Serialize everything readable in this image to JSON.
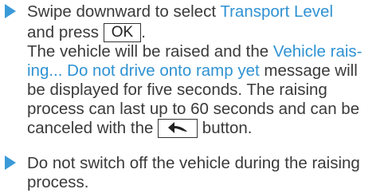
{
  "steps": [
    {
      "intro": "Swipe downward to select ",
      "highlight1": "Transport Level",
      "and_press": "and press ",
      "key_label": "OK",
      "period": ".",
      "line_a": "The vehicle will be raised and the ",
      "highlight2a": "Vehicle rais-",
      "highlight2b": "ing... Do not drive onto ramp yet",
      "line_b": " message will",
      "line_c": "be displayed for five seconds. The raising",
      "line_d": "process can last up to 60 seconds and can be",
      "line_e": "canceled with the ",
      "line_e_end": " button."
    },
    {
      "line_a": "Do not switch off the vehicle during the raising",
      "line_b": "process."
    }
  ],
  "icons": {
    "back_key": "back-arrow-icon"
  },
  "colors": {
    "accent": "#2f92d2",
    "bullet": "#3a9ad9",
    "text": "#3a3a3a"
  }
}
